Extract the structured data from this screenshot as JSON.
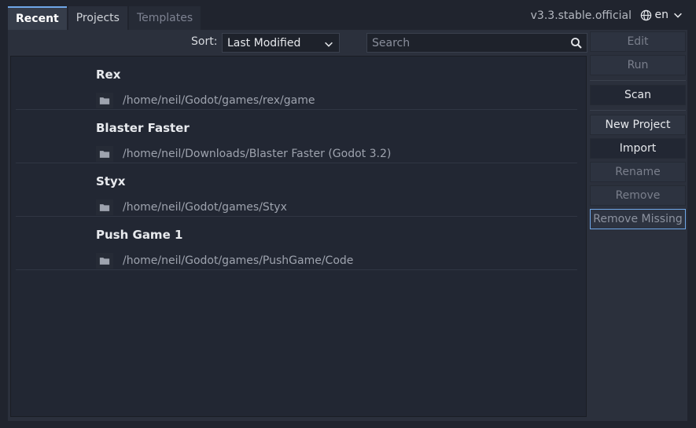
{
  "tabs": [
    {
      "label": "Recent"
    },
    {
      "label": "Projects"
    },
    {
      "label": "Templates"
    }
  ],
  "version": "v3.3.stable.official",
  "language": {
    "label": "en",
    "icon": "globe-icon"
  },
  "sort": {
    "label": "Sort:",
    "selected": "Last Modified"
  },
  "search": {
    "placeholder": "Search",
    "value": ""
  },
  "projects": [
    {
      "name": "Rex",
      "path": "/home/neil/Godot/games/rex/game"
    },
    {
      "name": "Blaster Faster",
      "path": "/home/neil/Downloads/Blaster Faster (Godot 3.2)"
    },
    {
      "name": "Styx",
      "path": "/home/neil/Godot/games/Styx"
    },
    {
      "name": "Push Game 1",
      "path": "/home/neil/Godot/games/PushGame/Code"
    }
  ],
  "buttons": {
    "edit": "Edit",
    "run": "Run",
    "scan": "Scan",
    "new_project": "New Project",
    "import": "Import",
    "rename": "Rename",
    "remove": "Remove",
    "remove_missing": "Remove Missing"
  },
  "colors": {
    "background": "#20242e",
    "panel": "#2b303c",
    "list": "#222733",
    "accent": "#6fa7e8"
  }
}
